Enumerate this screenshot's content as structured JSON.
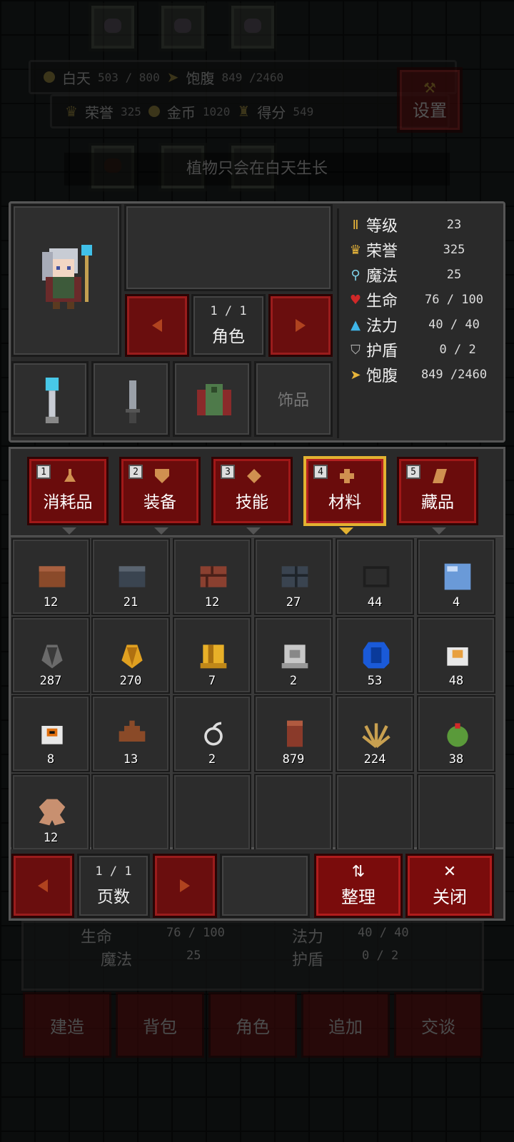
{
  "hud": {
    "day_label": "白天",
    "day_value": "503 / 800",
    "hunger_label": "饱腹",
    "hunger_value": "849 /2460",
    "honor_label": "荣誉",
    "honor_value": "325",
    "gold_label": "金币",
    "gold_value": "1020",
    "score_label": "得分",
    "score_value": "549",
    "settings_label": "设置"
  },
  "hint": "植物只会在白天生长",
  "character": {
    "page": "1 / 1",
    "page_label": "角色",
    "equip_accessory_label": "饰品",
    "stats": [
      {
        "icon": "level-icon",
        "label": "等级",
        "value": "23",
        "color": "#e8b53a"
      },
      {
        "icon": "crown-icon",
        "label": "荣誉",
        "value": "325",
        "color": "#e8b53a"
      },
      {
        "icon": "magic-icon",
        "label": "魔法",
        "value": "25",
        "color": "#7fd1e8"
      },
      {
        "icon": "heart-icon",
        "label": "生命",
        "value": "76 / 100",
        "color": "#d02828"
      },
      {
        "icon": "potion-icon",
        "label": "法力",
        "value": "40 / 40",
        "color": "#3fb5e8"
      },
      {
        "icon": "shield-icon",
        "label": "护盾",
        "value": " 0 / 2",
        "color": "#bbbbbb"
      },
      {
        "icon": "hunger-icon",
        "label": "饱腹",
        "value": "849 /2460",
        "color": "#e8b53a"
      }
    ]
  },
  "tabs": [
    {
      "num": "1",
      "label": "消耗品",
      "icon": "flask-icon"
    },
    {
      "num": "2",
      "label": "装备",
      "icon": "shield-icon"
    },
    {
      "num": "3",
      "label": "技能",
      "icon": "diamond-icon"
    },
    {
      "num": "4",
      "label": "材料",
      "icon": "sparkle-icon",
      "selected": true
    },
    {
      "num": "5",
      "label": "藏品",
      "icon": "scroll-icon"
    }
  ],
  "items": [
    {
      "name": "brown-block-icon",
      "count": "12"
    },
    {
      "name": "stone-block-icon",
      "count": "21"
    },
    {
      "name": "brick-icon",
      "count": "12"
    },
    {
      "name": "stone-brick-icon",
      "count": "27"
    },
    {
      "name": "dark-block-icon",
      "count": "44"
    },
    {
      "name": "glass-icon",
      "count": "4"
    },
    {
      "name": "coal-ore-icon",
      "count": "287"
    },
    {
      "name": "gold-ore-icon",
      "count": "270"
    },
    {
      "name": "gold-bar-icon",
      "count": "7"
    },
    {
      "name": "iron-bar-icon",
      "count": "2"
    },
    {
      "name": "sapphire-icon",
      "count": "53"
    },
    {
      "name": "egg-icon",
      "count": "48"
    },
    {
      "name": "skull-egg-icon",
      "count": "8"
    },
    {
      "name": "dung-icon",
      "count": "13"
    },
    {
      "name": "string-icon",
      "count": "2"
    },
    {
      "name": "log-icon",
      "count": "879"
    },
    {
      "name": "wheat-icon",
      "count": "224"
    },
    {
      "name": "cactus-icon",
      "count": "38"
    },
    {
      "name": "leather-icon",
      "count": "12"
    }
  ],
  "bottom": {
    "page": "1 / 1",
    "page_label": "页数",
    "sort_label": "整理",
    "close_label": "关闭"
  },
  "ghost": {
    "hp_label": "生命",
    "hp_value": "76 / 100",
    "mp_label": "法力",
    "mp_value": "40 / 40",
    "magic_label": "魔法",
    "magic_value": "25",
    "shield_label": "护盾",
    "shield_value": "0 / 2"
  },
  "nav": [
    "建造",
    "背包",
    "角色",
    "追加",
    "交谈"
  ]
}
